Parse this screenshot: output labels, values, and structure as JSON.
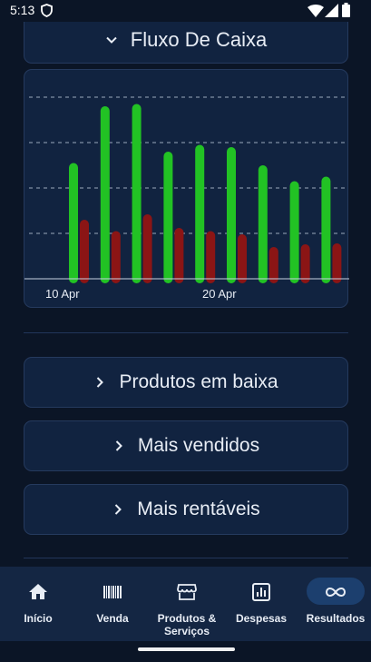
{
  "status_bar": {
    "time": "5:13"
  },
  "cash_flow": {
    "title": "Fluxo De Caixa",
    "chart_data": {
      "type": "bar",
      "x_tick_labels": [
        "10 Apr",
        "20 Apr"
      ],
      "ylim": [
        0,
        4
      ],
      "grid": true,
      "series": [
        {
          "color": "#22c224",
          "values": [
            2.55,
            3.8,
            3.85,
            2.8,
            2.95,
            2.9,
            2.5,
            2.15,
            2.25
          ]
        },
        {
          "color": "#8b1515",
          "values": [
            1.3,
            1.05,
            1.42,
            1.12,
            1.05,
            0.98,
            0.7,
            0.76,
            0.78
          ]
        }
      ]
    }
  },
  "sections": {
    "low_products": "Produtos em baixa",
    "best_sellers": "Mais vendidos",
    "most_profitable": "Mais rentáveis"
  },
  "nav": {
    "items": [
      {
        "label": "Início",
        "icon": "home-icon"
      },
      {
        "label": "Venda",
        "icon": "barcode-icon"
      },
      {
        "label": "Produtos & Serviços",
        "icon": "store-icon"
      },
      {
        "label": "Despesas",
        "icon": "report-icon"
      },
      {
        "label": "Resultados",
        "icon": "infinity-icon",
        "active": true
      }
    ]
  }
}
